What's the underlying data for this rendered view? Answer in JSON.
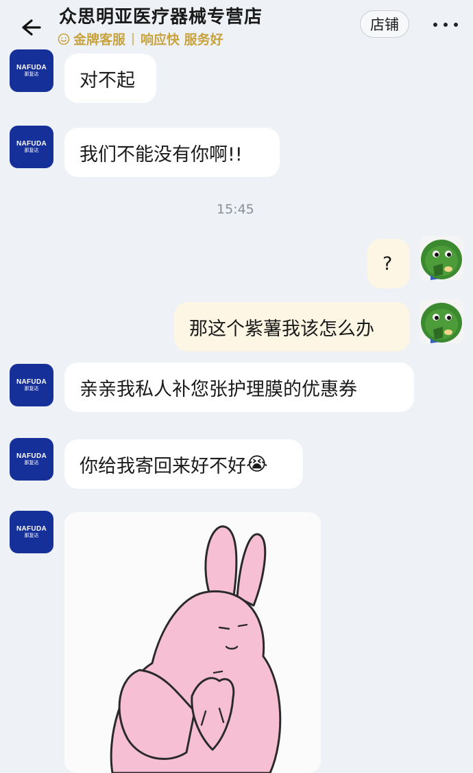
{
  "header": {
    "title": "众思明亚医疗器械专营店",
    "service_tags": [
      "金牌客服",
      "响应快 服务好"
    ],
    "shop_button_label": "店铺"
  },
  "shop_avatar": {
    "brand": "NAFUDA",
    "sub": "那复达"
  },
  "messages": [
    {
      "from": "shop",
      "text": "对不起"
    },
    {
      "from": "shop",
      "text": "我们不能没有你啊!!"
    },
    {
      "type": "time",
      "text": "15:45"
    },
    {
      "from": "me",
      "text": "?"
    },
    {
      "from": "me",
      "text": "那这个紫薯我该怎么办"
    },
    {
      "from": "shop",
      "text": "亲亲我私人补您张护理膜的优惠券"
    },
    {
      "from": "shop",
      "text": "你给我寄回来好不好",
      "emoji": "😭"
    },
    {
      "from": "shop",
      "type": "sticker",
      "sticker": "pink-rabbit-pleading"
    }
  ],
  "colors": {
    "background": "#eef2f6",
    "shop_bubble": "#ffffff",
    "my_bubble": "#fdf6e4",
    "gold": "#c8a23c",
    "shop_avatar": "#16309a"
  }
}
